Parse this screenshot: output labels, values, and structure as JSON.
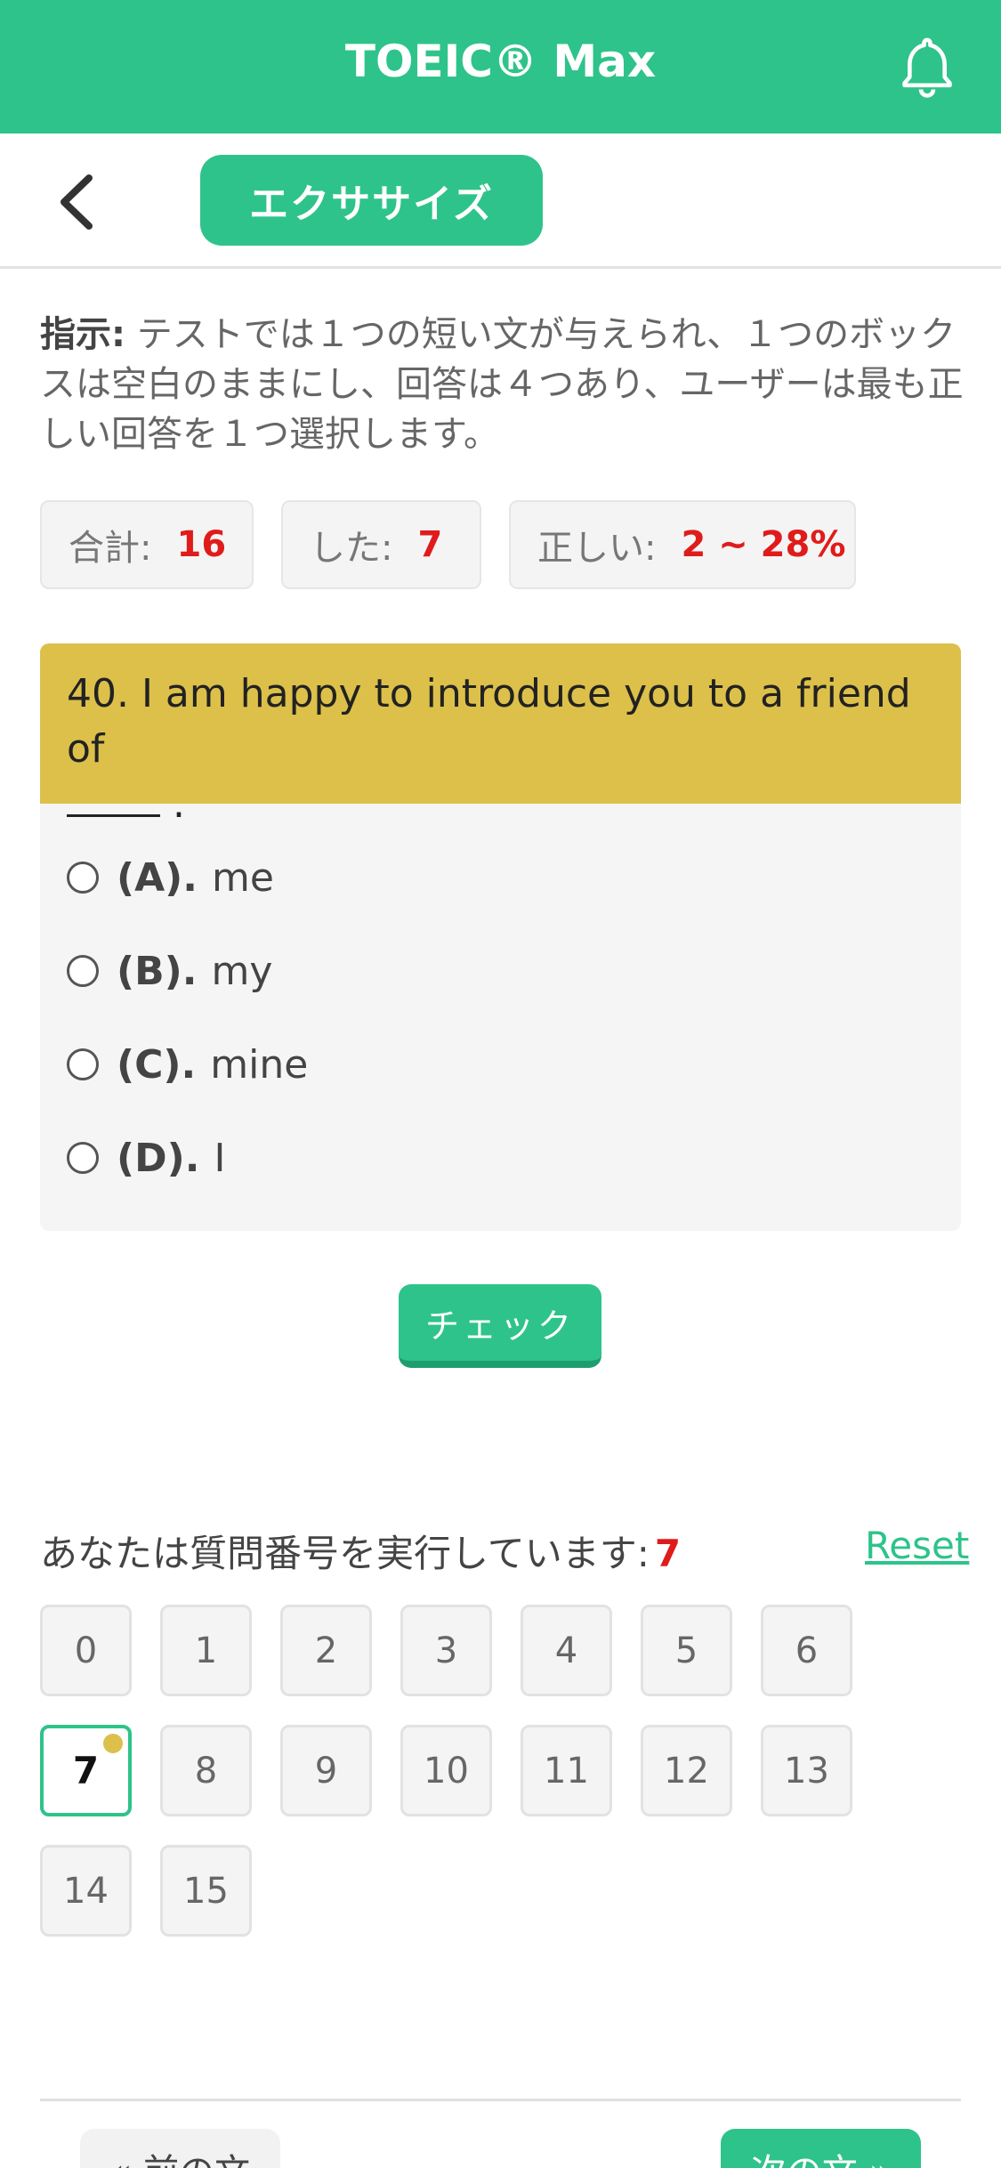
{
  "header": {
    "title": "TOEIC® Max",
    "bell_icon": "bell-icon"
  },
  "subnav": {
    "back_icon": "chevron-left-icon",
    "tab_label": "エクササイズ"
  },
  "instructions": {
    "label": "指示:",
    "text": "テストでは１つの短い文が与えられ、１つのボックスは空白のままにし、回答は４つあり、ユーザーは最も正しい回答を１つ選択します。"
  },
  "stats": {
    "total_label": "合計:",
    "total_value": "16",
    "done_label": "した:",
    "done_value": "7",
    "correct_label": "正しい:",
    "correct_value": "2 ~ 28%"
  },
  "question": {
    "text": "40. I am happy to introduce you to a friend of",
    "end": ".",
    "options": [
      {
        "key": "(A).",
        "text": "me"
      },
      {
        "key": "(B).",
        "text": "my"
      },
      {
        "key": "(C).",
        "text": "mine"
      },
      {
        "key": "(D).",
        "text": "I"
      }
    ]
  },
  "check_button": "チェック",
  "progress": {
    "label": "あなたは質問番号を実行しています:",
    "current": "7",
    "reset": "Reset",
    "numbers": [
      "0",
      "1",
      "2",
      "3",
      "4",
      "5",
      "6",
      "7",
      "8",
      "9",
      "10",
      "11",
      "12",
      "13",
      "14",
      "15"
    ]
  },
  "footer": {
    "prev": "« 前の文",
    "next": "次の文 »"
  },
  "colors": {
    "accent": "#2ec38a",
    "question_header": "#dcc04a",
    "highlight": "#e01b1b"
  }
}
